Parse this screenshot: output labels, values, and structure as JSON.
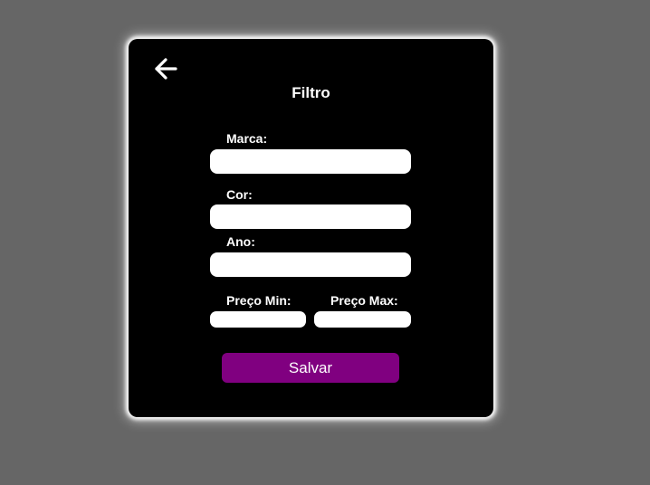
{
  "filter": {
    "title": "Filtro",
    "back_icon": "arrow-left-icon",
    "fields": {
      "marca": {
        "label": "Marca:",
        "value": ""
      },
      "cor": {
        "label": "Cor:",
        "value": ""
      },
      "ano": {
        "label": "Ano:",
        "value": ""
      },
      "preco_min": {
        "label": "Preço Min:",
        "value": ""
      },
      "preco_max": {
        "label": "Preço Max:",
        "value": ""
      }
    },
    "save_label": "Salvar"
  },
  "colors": {
    "page_background": "#666666",
    "modal_background": "#000000",
    "accent": "#800080",
    "text": "#ffffff"
  }
}
